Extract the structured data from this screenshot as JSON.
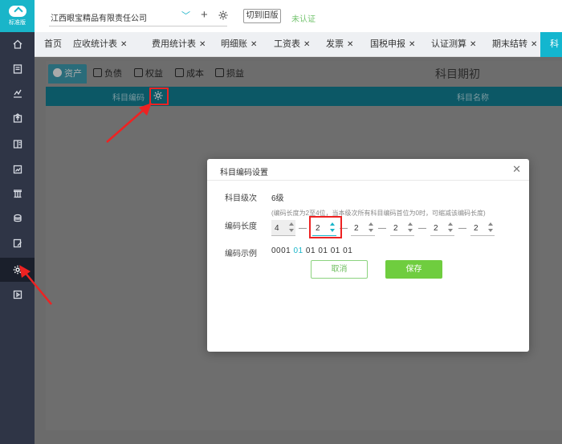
{
  "app": {
    "logo_text": "标准版"
  },
  "header": {
    "company": "江西眼宝精品有限责任公司",
    "switch_old_label": "切到旧版",
    "status": "未认证"
  },
  "tabs": [
    {
      "label": "首页",
      "closable": false
    },
    {
      "label": "应收统计表",
      "closable": true
    },
    {
      "label": "费用统计表",
      "closable": true
    },
    {
      "label": "明细账",
      "closable": true
    },
    {
      "label": "工资表",
      "closable": true
    },
    {
      "label": "发票",
      "closable": true
    },
    {
      "label": "国税申报",
      "closable": true
    },
    {
      "label": "认证测算",
      "closable": true
    },
    {
      "label": "期末结转",
      "closable": true
    },
    {
      "label": "科",
      "closable": false
    }
  ],
  "subtabs": [
    "资产",
    "负债",
    "权益",
    "成本",
    "损益"
  ],
  "sheet_title": "科目期初",
  "table_headers": {
    "code": "科目编码",
    "name": "科目名称"
  },
  "modal": {
    "title": "科目编码设置",
    "level_label": "科目级次",
    "level_value": "6级",
    "hint": "(编码长度为2至4位，当本级次所有科目编码首位为0时，可缩减该编码长度)",
    "length_label": "编码长度",
    "lengths": [
      "4",
      "2",
      "2",
      "2",
      "2",
      "2"
    ],
    "example_label": "编码示例",
    "example_prefix": "0001 ",
    "example_highlight": "01",
    "example_suffix": " 01 01 01 01",
    "cancel_label": "取消",
    "save_label": "保存"
  },
  "colors": {
    "accent": "#19b5c9",
    "rail": "#2f3546",
    "save": "#6fcd3f",
    "annotation": "#e22222"
  }
}
